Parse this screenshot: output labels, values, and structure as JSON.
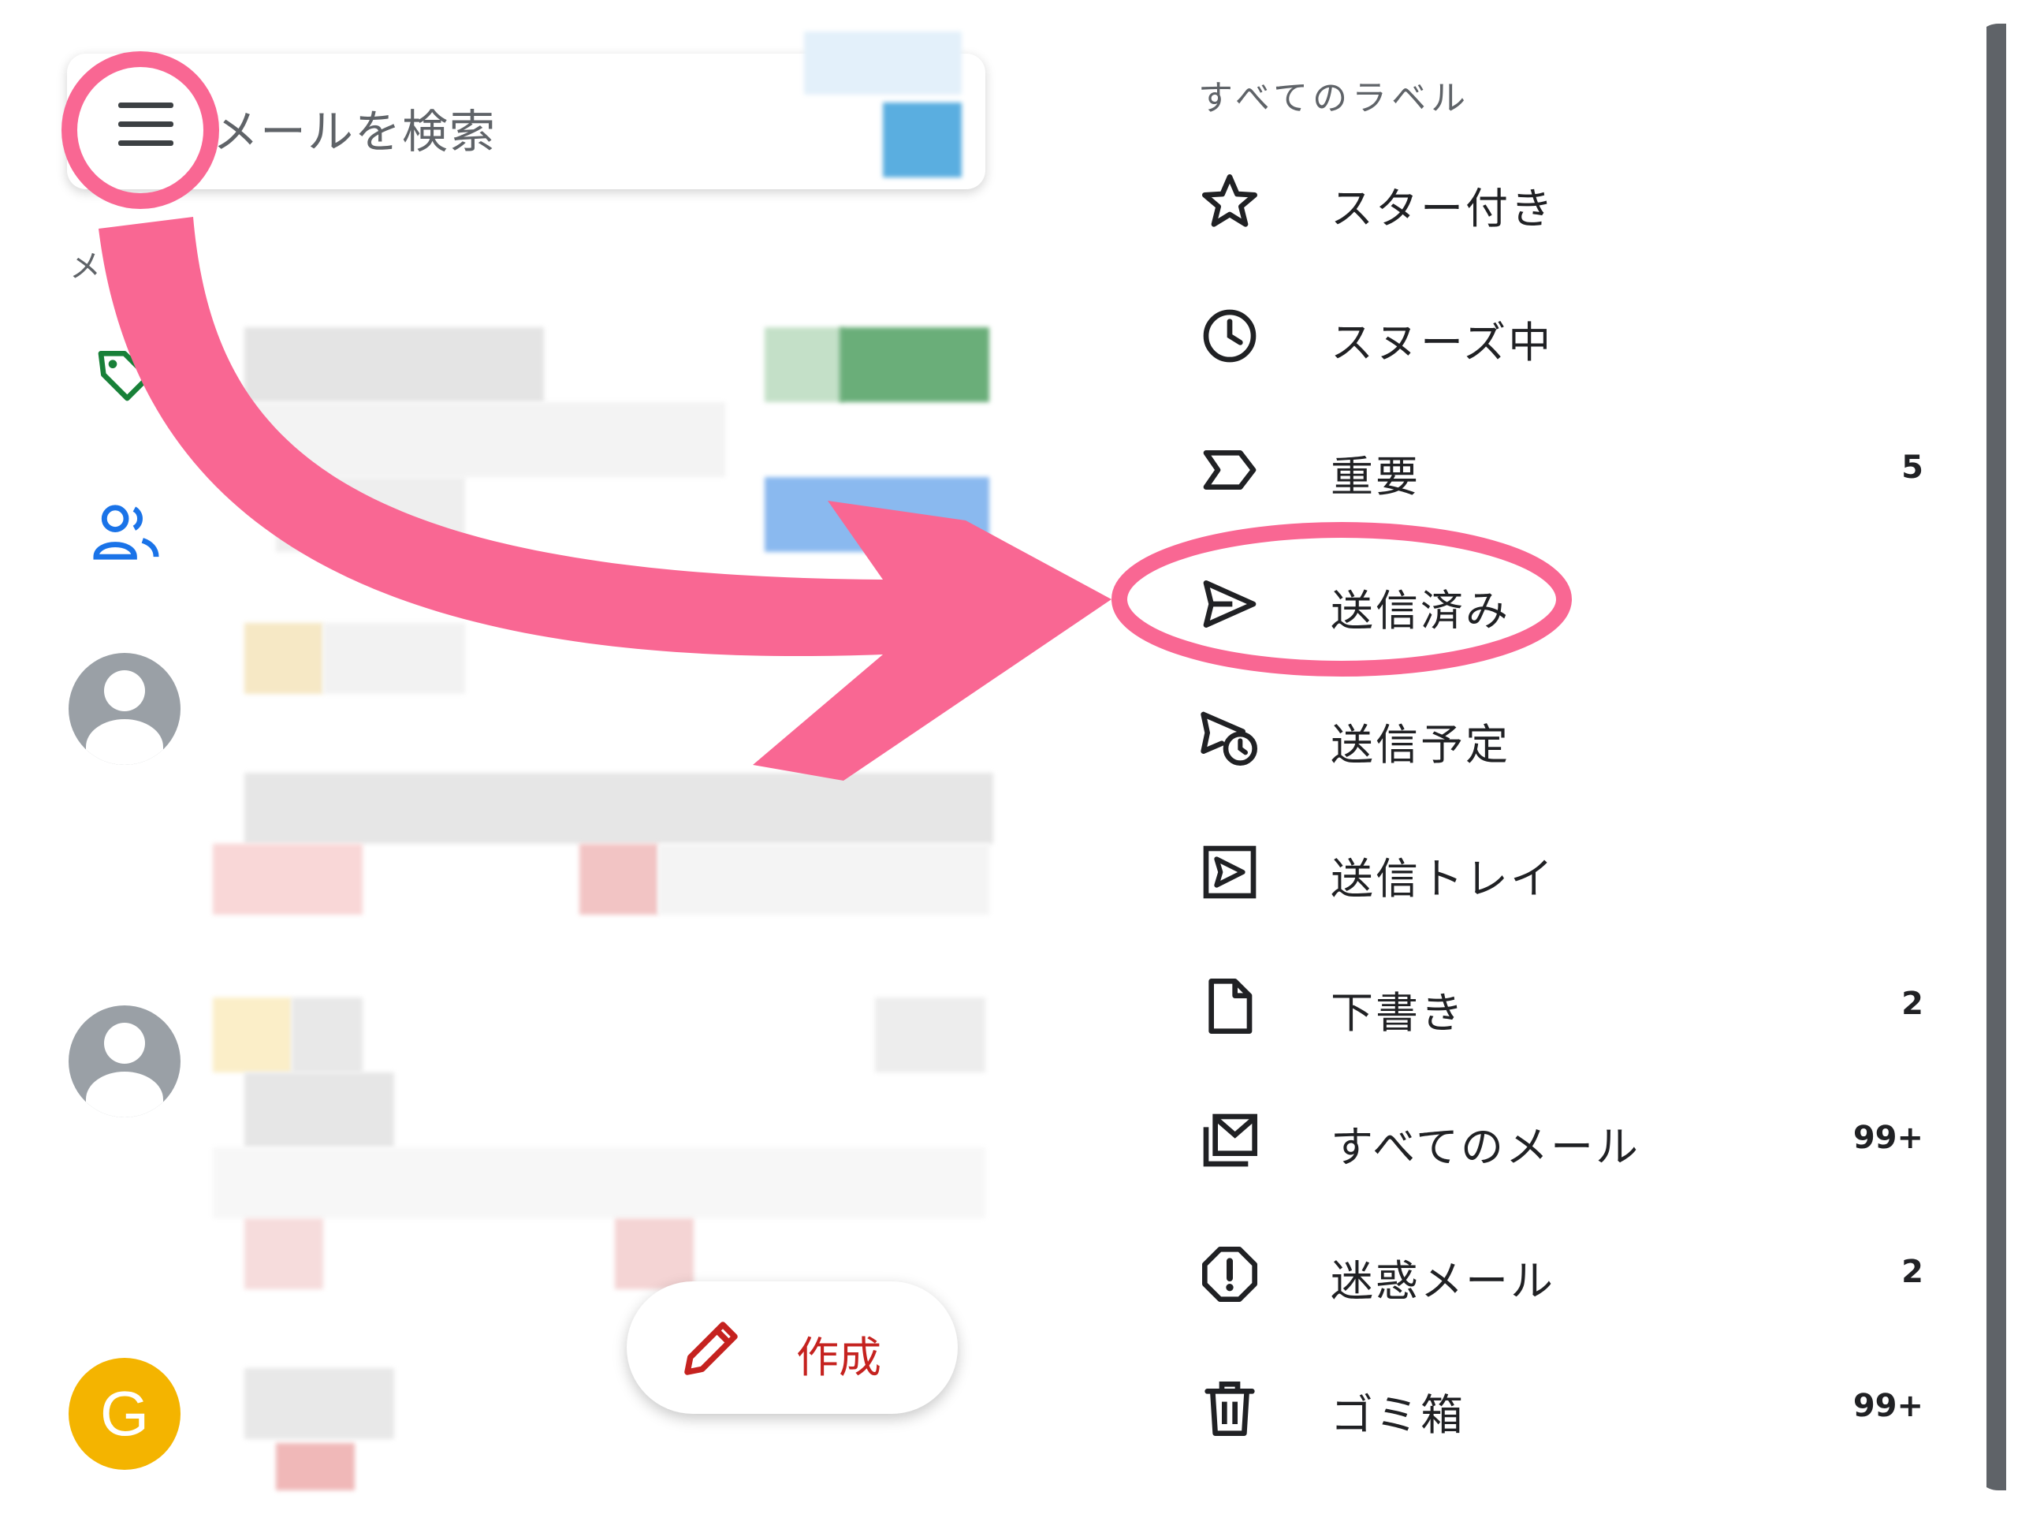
{
  "search": {
    "placeholder": "メールを検索"
  },
  "side": {
    "label": "メ"
  },
  "avatar_letter": "G",
  "compose": {
    "label": "作成"
  },
  "drawer": {
    "heading": "すべてのラベル",
    "items": [
      {
        "label": "スター付き",
        "icon": "star-icon",
        "count": ""
      },
      {
        "label": "スヌーズ中",
        "icon": "clock-icon",
        "count": ""
      },
      {
        "label": "重要",
        "icon": "important-icon",
        "count": "5"
      },
      {
        "label": "送信済み",
        "icon": "send-icon",
        "count": ""
      },
      {
        "label": "送信予定",
        "icon": "scheduled-send-icon",
        "count": ""
      },
      {
        "label": "送信トレイ",
        "icon": "outbox-icon",
        "count": ""
      },
      {
        "label": "下書き",
        "icon": "draft-icon",
        "count": "2"
      },
      {
        "label": "すべてのメール",
        "icon": "all-mail-icon",
        "count": "99+"
      },
      {
        "label": "迷惑メール",
        "icon": "spam-icon",
        "count": "2"
      },
      {
        "label": "ゴミ箱",
        "icon": "trash-icon",
        "count": "99+"
      }
    ]
  },
  "colors": {
    "annotation_pink": "#f96793",
    "compose_red": "#c5221f",
    "tag_green": "#188038",
    "people_blue": "#1a73e8",
    "avatar_gray": "#9aa0a6",
    "avatar_yellow": "#f4b400"
  }
}
